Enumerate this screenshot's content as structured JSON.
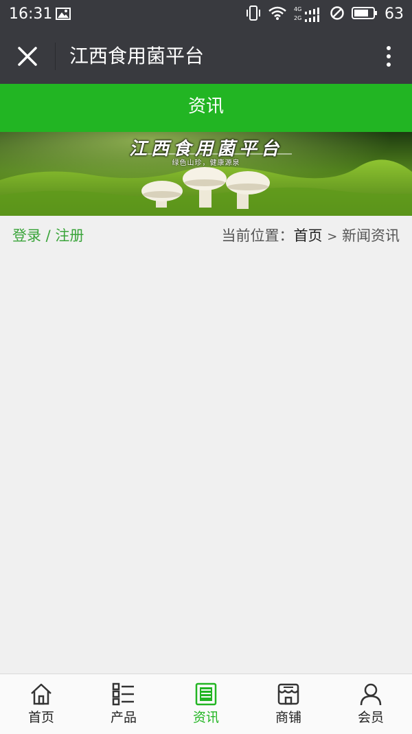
{
  "status_bar": {
    "time": "16:31",
    "network_top": "4G",
    "network_bottom": "2G",
    "battery": "63"
  },
  "titlebar": {
    "title": "江西食用菌平台",
    "close_icon": "close-icon",
    "more_icon": "more-vertical-icon"
  },
  "page_header": {
    "title": "资讯"
  },
  "banner": {
    "title": "江西食用菌平台",
    "subtitle": "绿色山珍，健康源泉"
  },
  "info_row": {
    "login_text": "登录 / 注册",
    "location_prefix": "当前位置：",
    "home": "首页",
    "separator": ">",
    "current": "新闻资讯"
  },
  "tabbar": {
    "tabs": [
      {
        "label": "首页",
        "icon": "home-icon",
        "active": false
      },
      {
        "label": "产品",
        "icon": "list-icon",
        "active": false
      },
      {
        "label": "资讯",
        "icon": "news-icon",
        "active": true
      },
      {
        "label": "商铺",
        "icon": "shop-icon",
        "active": false
      },
      {
        "label": "会员",
        "icon": "user-icon",
        "active": false
      }
    ]
  },
  "colors": {
    "bar_dark": "#393a3f",
    "brand_green": "#22b523",
    "link_green": "#3aa43a",
    "background": "#f0f0f0"
  }
}
